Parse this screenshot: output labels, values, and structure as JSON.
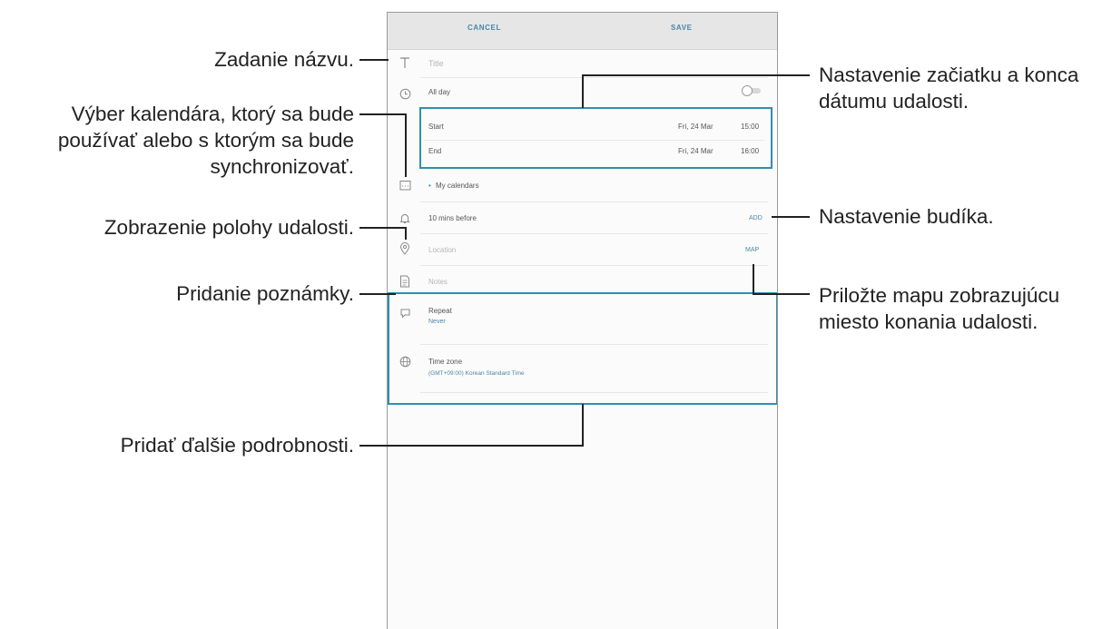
{
  "phone": {
    "topbar": {
      "cancel": "CANCEL",
      "save": "SAVE"
    },
    "title_placeholder": "Title",
    "all_day": "All day",
    "start": {
      "label": "Start",
      "date": "Fri, 24 Mar",
      "time": "15:00"
    },
    "end": {
      "label": "End",
      "date": "Fri, 24 Mar",
      "time": "16:00"
    },
    "calendar": "My calendars",
    "reminder": {
      "label": "10 mins before",
      "action": "ADD"
    },
    "location": {
      "placeholder": "Location",
      "action": "MAP"
    },
    "notes_placeholder": "Notes",
    "repeat": {
      "label": "Repeat",
      "value": "Never"
    },
    "time_zone": {
      "label": "Time zone",
      "value": "(GMT+09:00) Korean Standard Time"
    }
  },
  "callouts": {
    "title": "Zadanie názvu.",
    "calendar": [
      "Výber kalendára, ktorý sa bude",
      "používať alebo s ktorým sa bude",
      "synchronizovať."
    ],
    "location": "Zobrazenie polohy udalosti.",
    "notes": "Pridanie poznámky.",
    "datetime": [
      "Nastavenie začiatku a konca",
      "dátumu udalosti."
    ],
    "alarm": "Nastavenie budíka.",
    "map": [
      "Priložte mapu zobrazujúcu",
      "miesto konania udalosti."
    ],
    "details": "Pridať ďalšie podrobnosti."
  },
  "colors": {
    "highlight": "#2f8fae",
    "accent_text": "#4a86a6"
  }
}
